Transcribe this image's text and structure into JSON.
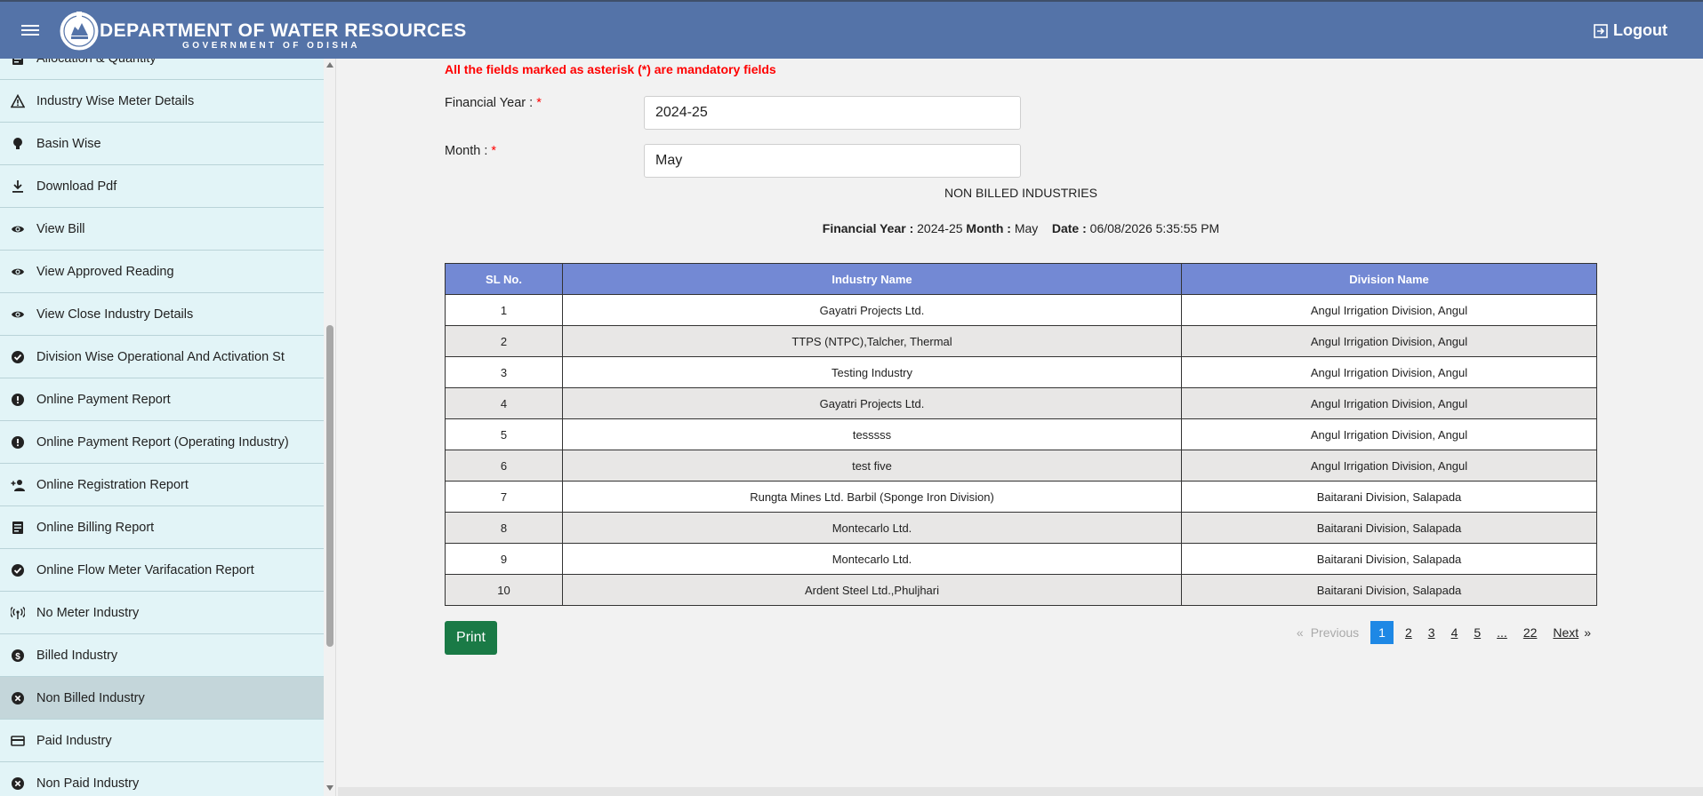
{
  "header": {
    "title": "DEPARTMENT OF WATER RESOURCES",
    "subtitle": "GOVERNMENT OF ODISHA",
    "logout_label": "Logout",
    "bg_color": "#5473a8"
  },
  "sidebar": {
    "items": [
      {
        "label": "Allocation & Quantity",
        "icon": "list-icon",
        "active": false
      },
      {
        "label": "Industry Wise Meter Details",
        "icon": "warning-icon",
        "active": false
      },
      {
        "label": "Basin Wise",
        "icon": "bulb-icon",
        "active": false
      },
      {
        "label": "Download Pdf",
        "icon": "download-icon",
        "active": false
      },
      {
        "label": "View Bill",
        "icon": "eye-icon",
        "active": false
      },
      {
        "label": "View Approved Reading",
        "icon": "eye-icon",
        "active": false
      },
      {
        "label": "View Close Industry Details",
        "icon": "eye-icon",
        "active": false
      },
      {
        "label": "Division Wise Operational And Activation St",
        "icon": "check-circle-icon",
        "active": false
      },
      {
        "label": "Online Payment Report",
        "icon": "exclamation-circle-icon",
        "active": false
      },
      {
        "label": "Online Payment Report (Operating Industry)",
        "icon": "exclamation-circle-icon",
        "active": false
      },
      {
        "label": "Online Registration Report",
        "icon": "person-add-icon",
        "active": false
      },
      {
        "label": "Online Billing Report",
        "icon": "list-icon",
        "active": false
      },
      {
        "label": "Online Flow Meter Varifacation Report",
        "icon": "check-circle-icon",
        "active": false
      },
      {
        "label": "No Meter Industry",
        "icon": "antenna-icon",
        "active": false
      },
      {
        "label": "Billed Industry",
        "icon": "dollar-circle-icon",
        "active": false
      },
      {
        "label": "Non Billed Industry",
        "icon": "x-circle-icon",
        "active": true
      },
      {
        "label": "Paid Industry",
        "icon": "card-icon",
        "active": false
      },
      {
        "label": "Non Paid Industry",
        "icon": "x-circle-icon",
        "active": false
      }
    ]
  },
  "form": {
    "mandatory_note": "All the fields marked as asterisk (*) are mandatory fields",
    "financial_year_label": "Financial Year :",
    "financial_year_value": "2024-25",
    "month_label": "Month :",
    "month_value": "May",
    "required_star": "*"
  },
  "report": {
    "title": "NON BILLED INDUSTRIES",
    "fy_label": "Financial Year :",
    "fy_value": "2024-25",
    "month_label": "Month :",
    "month_value": "May",
    "date_label": "Date :",
    "date_value": "06/08/2026 5:35:55 PM"
  },
  "table": {
    "columns": [
      "SL No.",
      "Industry Name",
      "Division Name"
    ],
    "rows": [
      [
        "1",
        "Gayatri Projects Ltd.",
        "Angul Irrigation Division, Angul"
      ],
      [
        "2",
        "TTPS (NTPC),Talcher, Thermal",
        "Angul Irrigation Division, Angul"
      ],
      [
        "3",
        "Testing Industry",
        "Angul Irrigation Division, Angul"
      ],
      [
        "4",
        "Gayatri Projects Ltd.",
        "Angul Irrigation Division, Angul"
      ],
      [
        "5",
        "tesssss",
        "Angul Irrigation Division, Angul"
      ],
      [
        "6",
        "test five",
        "Angul Irrigation Division, Angul"
      ],
      [
        "7",
        "Rungta Mines Ltd. Barbil (Sponge Iron Division)",
        "Baitarani Division, Salapada"
      ],
      [
        "8",
        "Montecarlo Ltd.",
        "Baitarani Division, Salapada"
      ],
      [
        "9",
        "Montecarlo Ltd.",
        "Baitarani Division, Salapada"
      ],
      [
        "10",
        "Ardent Steel Ltd.,Phuljhari",
        "Baitarani Division, Salapada"
      ]
    ]
  },
  "actions": {
    "print_label": "Print",
    "print_color": "#1a7a46"
  },
  "pagination": {
    "prev_arrow": "«",
    "previous": "Previous",
    "pages": [
      "1",
      "2",
      "3",
      "4",
      "5",
      "...",
      "22"
    ],
    "current": "1",
    "next": "Next",
    "next_arrow": "»",
    "current_color": "#1e88e5"
  }
}
